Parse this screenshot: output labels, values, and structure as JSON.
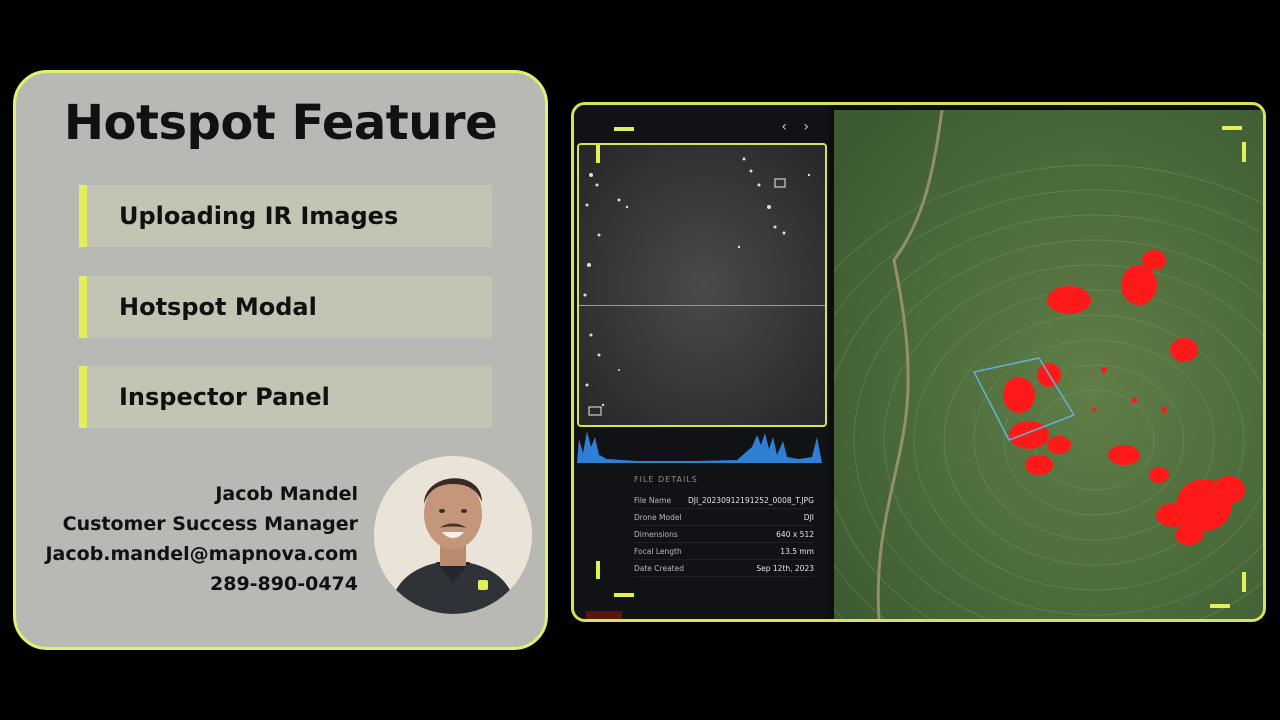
{
  "title": "Hotspot Feature",
  "menu": [
    {
      "label": "Uploading IR Images"
    },
    {
      "label": "Hotspot Modal"
    },
    {
      "label": "Inspector Panel"
    }
  ],
  "contact": {
    "name": "Jacob Mandel",
    "role": "Customer Success Manager",
    "email": "Jacob.mandel@mapnova.com",
    "phone": "289-890-0474"
  },
  "app": {
    "nav_arrows": "‹ ›",
    "file_details": {
      "title": "FILE DETAILS",
      "rows": [
        {
          "label": "File Name",
          "value": "DJI_20230912191252_0008_T.JPG"
        },
        {
          "label": "Drone Model",
          "value": "DJI"
        },
        {
          "label": "Dimensions",
          "value": "640 x 512"
        },
        {
          "label": "Focal Length",
          "value": "13.5 mm"
        },
        {
          "label": "Date Created",
          "value": "Sep 12th, 2023"
        }
      ]
    }
  },
  "colors": {
    "accent": "#e3ef5a",
    "hotspot": "#ff1a1a",
    "selection": "#5fb3d9",
    "histogram": "#2f7fd6"
  }
}
